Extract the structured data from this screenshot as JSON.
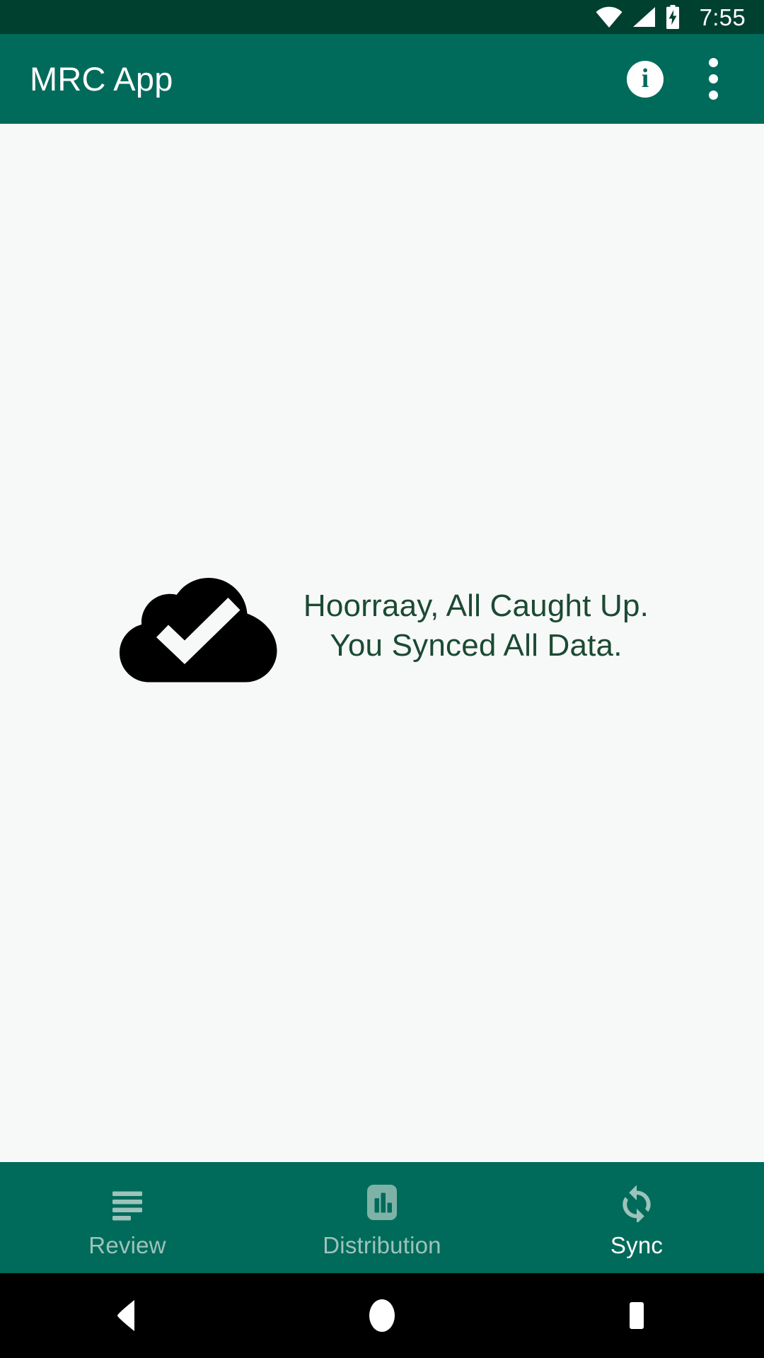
{
  "status_bar": {
    "clock": "7:55",
    "icons": [
      {
        "name": "wifi-icon",
        "label": "wifi"
      },
      {
        "name": "cellular-signal-icon",
        "label": "cellular signal"
      },
      {
        "name": "battery-charging-icon",
        "label": "battery charging"
      }
    ],
    "background_color": "#00402f"
  },
  "app_bar": {
    "title": "MRC App",
    "background_color": "#006b5b",
    "title_color": "#ffffff",
    "info_action_label": "i",
    "info_icon": "info-icon",
    "overflow_icon": "more-vert-icon"
  },
  "content": {
    "background_color": "#f7f8f8",
    "sync_icon": "cloud-done-icon",
    "sync_icon_color": "#000000",
    "message_color": "#1b4a33",
    "message_line_1": "Hoorraay, All Caught Up.",
    "message_line_2": "You Synced All Data."
  },
  "bottom_nav": {
    "background_color": "#006b5b",
    "inactive_color": "#9dc3ba",
    "active_color": "#ffffff",
    "items": [
      {
        "label": "Review",
        "icon": "list-lines-icon",
        "active": false
      },
      {
        "label": "Distribution",
        "icon": "insert-chart-icon",
        "active": false
      },
      {
        "label": "Sync",
        "icon": "sync-icon",
        "active": true
      }
    ]
  },
  "system_nav": {
    "background_color": "#000000",
    "buttons": [
      {
        "name": "back-button",
        "icon": "back-triangle-icon"
      },
      {
        "name": "home-button",
        "icon": "home-circle-icon"
      },
      {
        "name": "recents-button",
        "icon": "recents-square-icon"
      }
    ]
  }
}
